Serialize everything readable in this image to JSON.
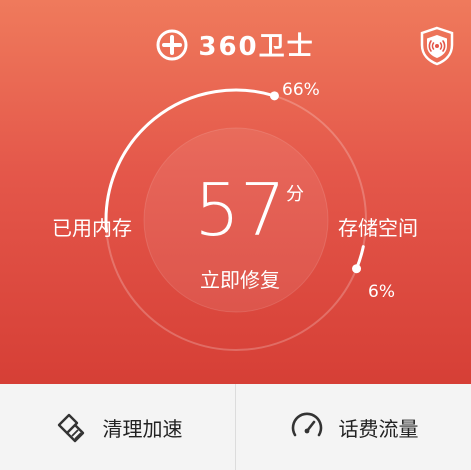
{
  "header": {
    "app_name": "360卫士"
  },
  "gauge": {
    "score": "57",
    "score_unit": "分",
    "action_label": "立即修复",
    "left_label": "已用内存",
    "right_label": "存储空间",
    "memory_percent_label": "66%",
    "storage_percent_label": "6%",
    "memory_percent": 66,
    "storage_percent": 6
  },
  "bottom_bar": {
    "clean_label": "清理加速",
    "data_label": "话费流量"
  },
  "colors": {
    "accent": "#e4574a",
    "light": "#ffffff"
  },
  "icons": {
    "logo": "360-logo-icon",
    "shield": "shield-signal-icon",
    "clean": "broom-icon",
    "data": "speedometer-icon"
  }
}
